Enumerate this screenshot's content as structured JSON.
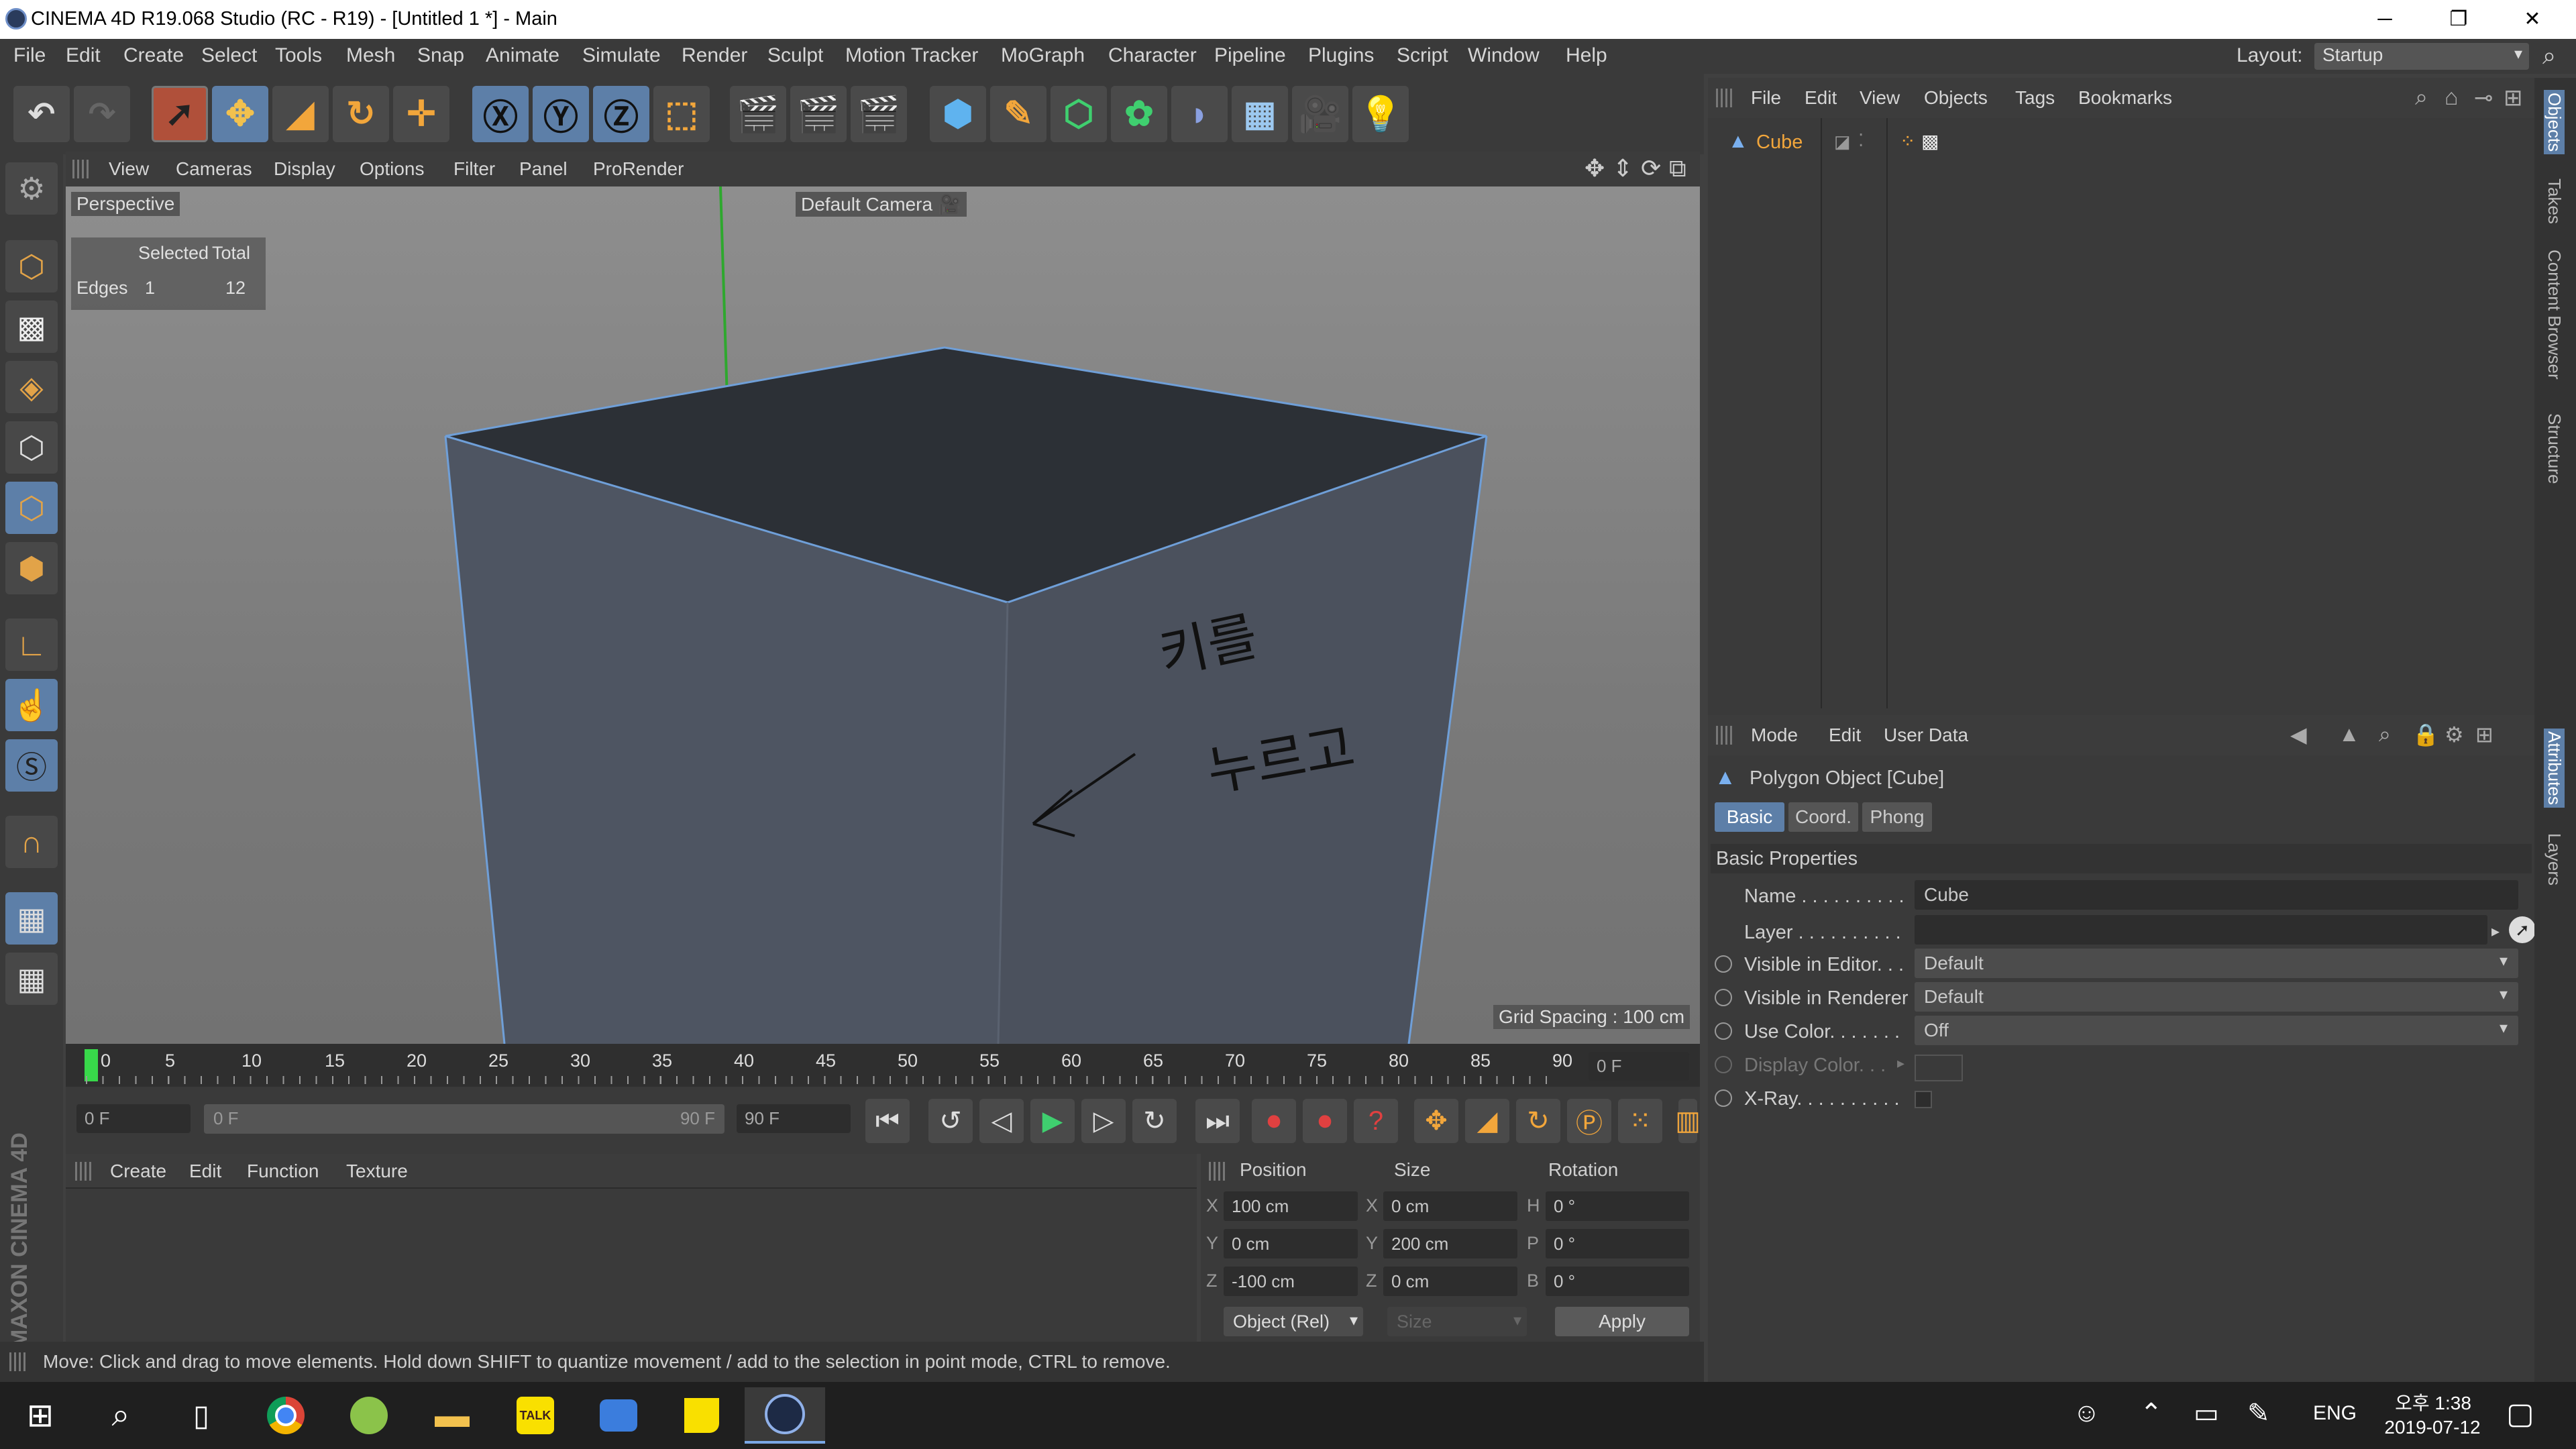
{
  "window": {
    "title": "CINEMA 4D R19.068 Studio (RC - R19) - [Untitled 1 *] - Main",
    "minimize": "─",
    "restore": "❐",
    "close": "✕"
  },
  "menubar": {
    "items": [
      "File",
      "Edit",
      "Create",
      "Select",
      "Tools",
      "Mesh",
      "Snap",
      "Animate",
      "Simulate",
      "Render",
      "Sculpt",
      "Motion Tracker",
      "MoGraph",
      "Character",
      "Pipeline",
      "Plugins",
      "Script",
      "Window",
      "Help"
    ],
    "layout_label": "Layout:",
    "layout_value": "Startup"
  },
  "viewport": {
    "menu": [
      "View",
      "Cameras",
      "Display",
      "Options",
      "Filter",
      "Panel",
      "ProRender"
    ],
    "view_name": "Perspective",
    "camera_label": "Default Camera",
    "stats": {
      "h1": "Selected",
      "h2": "Total",
      "row_label": "Edges",
      "selected": "1",
      "total": "12"
    },
    "grid_spacing": "Grid Spacing : 100 cm",
    "handwriting": [
      "키를",
      "누르고"
    ]
  },
  "timeline": {
    "ticks": [
      "0",
      "5",
      "10",
      "15",
      "20",
      "25",
      "30",
      "35",
      "40",
      "45",
      "50",
      "55",
      "60",
      "65",
      "70",
      "75",
      "80",
      "85",
      "90"
    ],
    "current_frame": "0 F",
    "start_frame": "0 F",
    "range_start": "0 F",
    "range_end": "90 F",
    "end_frame": "90 F"
  },
  "material_manager": {
    "menu": [
      "Create",
      "Edit",
      "Function",
      "Texture"
    ]
  },
  "coordinates": {
    "headers": [
      "Position",
      "Size",
      "Rotation"
    ],
    "rows": [
      {
        "axis": "X",
        "pos": "100 cm",
        "size_axis": "X",
        "size": "0 cm",
        "rot_axis": "H",
        "rot": "0 °"
      },
      {
        "axis": "Y",
        "pos": "0 cm",
        "size_axis": "Y",
        "size": "200 cm",
        "rot_axis": "P",
        "rot": "0 °"
      },
      {
        "axis": "Z",
        "pos": "-100 cm",
        "size_axis": "Z",
        "size": "0 cm",
        "rot_axis": "B",
        "rot": "0 °"
      }
    ],
    "mode": "Object (Rel)",
    "size_mode": "Size",
    "apply": "Apply"
  },
  "status": "Move: Click and drag to move elements. Hold down SHIFT to quantize movement / add to the selection in point mode, CTRL to remove.",
  "object_manager": {
    "menu": [
      "File",
      "Edit",
      "View",
      "Objects",
      "Tags",
      "Bookmarks"
    ],
    "object_name": "Cube"
  },
  "attributes": {
    "menu": [
      "Mode",
      "Edit",
      "User Data"
    ],
    "title": "Polygon Object [Cube]",
    "tabs": [
      "Basic",
      "Coord.",
      "Phong"
    ],
    "section": "Basic Properties",
    "fields": {
      "name_label": "Name . . . . . . . . . .",
      "name_value": "Cube",
      "layer_label": "Layer . . . . . . . . . .",
      "vis_editor_label": "Visible in Editor. . .",
      "vis_editor_value": "Default",
      "vis_renderer_label": "Visible in Renderer",
      "vis_renderer_value": "Default",
      "use_color_label": "Use Color. . . . . . .",
      "use_color_value": "Off",
      "display_color_label": "Display Color. . .",
      "xray_label": "X-Ray. . . . . . . . . ."
    }
  },
  "right_tabs": [
    "Objects",
    "Takes",
    "Content Browser",
    "Structure",
    "Attributes",
    "Layers"
  ],
  "branding": "MAXON CINEMA 4D",
  "taskbar": {
    "lang": "ENG",
    "time": "오후 1:38",
    "date": "2019-07-12"
  },
  "colors": {
    "accent": "#5d7fa8",
    "panel": "#3a3a3a",
    "cube_face": "#4f5662",
    "cube_top": "#2b2f35",
    "edge": "#6f9fd8"
  }
}
